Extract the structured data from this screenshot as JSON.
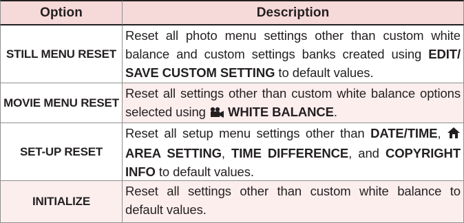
{
  "table": {
    "headers": {
      "option": "Option",
      "description": "Description"
    },
    "rows": [
      {
        "option": "STILL MENU RESET",
        "desc_1": "Reset all photo menu settings other than custom white balance and custom settings banks created using ",
        "desc_b1": "EDIT/ SAVE CUSTOM SETTING",
        "desc_2": " to default values."
      },
      {
        "option": "MOVIE MENU RESET",
        "desc_1": "Reset all settings other than custom white balance op­tions selected using ",
        "icon": "movie-camera-icon",
        "desc_b1": " WHITE BALANCE",
        "desc_2": "."
      },
      {
        "option": "SET-UP RESET",
        "desc_1": "Reset all setup menu settings other than ",
        "desc_b1": "DATE/TIME",
        "desc_2": ", ",
        "icon": "home-icon",
        "desc_b2": " AREA SETTING",
        "desc_3": ", ",
        "desc_b3": "TIME DIFFERENCE",
        "desc_4": ", and ",
        "desc_b4": "COPYRIGHT INFO",
        "desc_5": " to default values."
      },
      {
        "option": "INITIALIZE",
        "desc_1": "Reset all settings other than custom white balance to default values."
      }
    ]
  },
  "colors": {
    "header_bg": "#f6d9d9",
    "alt_bg": "#fdeeee",
    "border": "#8f8f8f",
    "text": "#231f20"
  }
}
